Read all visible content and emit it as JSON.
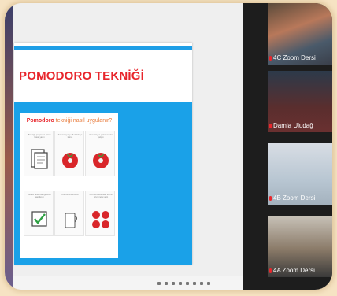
{
  "slide": {
    "title": "POMODORO TEKNİĞİ",
    "card_title_red": "Pomodoro",
    "card_title_orange": " tekniği nasıl uygulanır?",
    "steps": [
      {
        "text": "Bir kağıt parçasına görev listesi yazın",
        "icon": "document-icon"
      },
      {
        "text": "Zamanlayıcıyı 25 dakikaya kurun",
        "icon": "tomato-timer-icon"
      },
      {
        "text": "Zamanlayıcı çalana kadar çalışın",
        "icon": "tomato-timer-icon"
      },
      {
        "text": "Görevi tamamladığınızda işaretleyin",
        "icon": "checkmark-icon"
      },
      {
        "text": "Kısa bir mola verin",
        "icon": "coffee-cup-icon"
      },
      {
        "text": "Dört pomodorodan sonra uzun mola verin",
        "icon": "tomatoes-icon"
      }
    ]
  },
  "participants": [
    {
      "label": "4C Zoom Dersi"
    },
    {
      "label": "Damla Uludağ"
    },
    {
      "label": "4B Zoom Dersi"
    },
    {
      "label": "4A Zoom Dersi"
    }
  ],
  "colors": {
    "accent_blue": "#1aa1e8",
    "title_red": "#e8262c",
    "background": "#f6e3c3",
    "panel": "#1d1d1d"
  }
}
